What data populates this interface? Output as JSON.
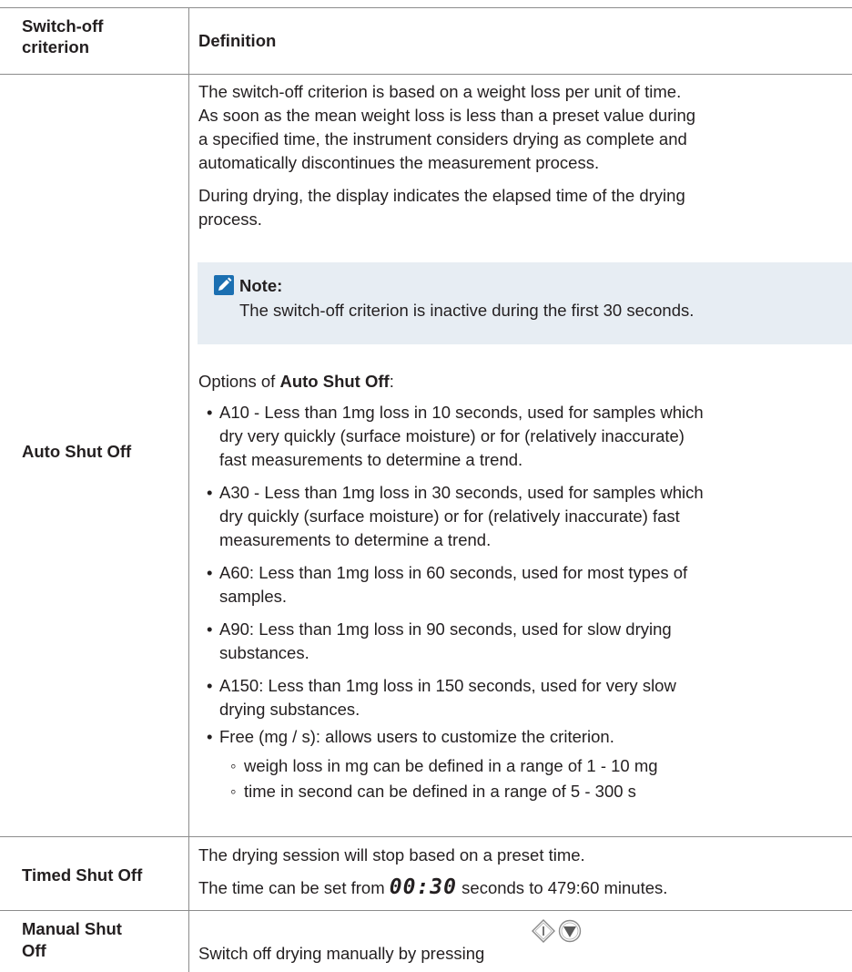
{
  "table": {
    "header": {
      "col1_line1": "Switch-off",
      "col1_line2": "criterion",
      "col2": "Definition"
    },
    "auto": {
      "label": "Auto Shut Off",
      "para1": [
        "The switch-off criterion is based on a weight loss per unit of time.",
        "As soon as the mean weight loss is less than a preset value during",
        "a specified time, the instrument considers drying as complete and",
        "automatically discontinues the measurement process."
      ],
      "para2": [
        "During drying, the display indicates the elapsed time of the drying",
        "process."
      ],
      "note_title": "Note:",
      "note_text": "The switch-off criterion is inactive during the first 30 seconds.",
      "options_prefix": "Options of ",
      "options_bold": "Auto Shut Off",
      "options_suffix": ":",
      "bullets": [
        [
          "A10 - Less than 1mg loss in 10 seconds, used for samples which",
          "dry very quickly (surface moisture) or for (relatively inaccurate)",
          "fast measurements to determine a trend."
        ],
        [
          "A30 - Less than 1mg loss in 30 seconds, used for samples which",
          "dry quickly (surface moisture) or for (relatively inaccurate) fast",
          "measurements to determine a trend."
        ],
        [
          "A60: Less than 1mg loss in 60 seconds, used for most types of",
          "samples."
        ],
        [
          "A90: Less than 1mg loss in 90 seconds, used for slow drying",
          "substances."
        ],
        [
          "A150: Less than 1mg loss in 150 seconds, used for very slow",
          "drying substances."
        ],
        [
          "Free (mg / s): allows users to customize the criterion."
        ]
      ],
      "sub_bullets": [
        "weigh loss in mg can be defined in a range of 1 - 10 mg",
        "time in second can be defined in a range of 5 - 300 s"
      ]
    },
    "timed": {
      "label": "Timed Shut Off",
      "line1": "The drying session will stop based on a preset time.",
      "line2_prefix": "The time can be set from ",
      "line2_display": "00:30",
      "line2_suffix": " seconds to 479:60 minutes."
    },
    "manual": {
      "label_line1": "Manual Shut",
      "label_line2": "Off",
      "text": "Switch off drying manually by pressing"
    }
  },
  "icons": {
    "note": "pencil-note-icon",
    "start": "start-key-icon",
    "down": "down-key-icon"
  },
  "colors": {
    "note_bg": "#e7edf3",
    "note_icon": "#1b6fb1",
    "rule": "#8c8c8c"
  }
}
